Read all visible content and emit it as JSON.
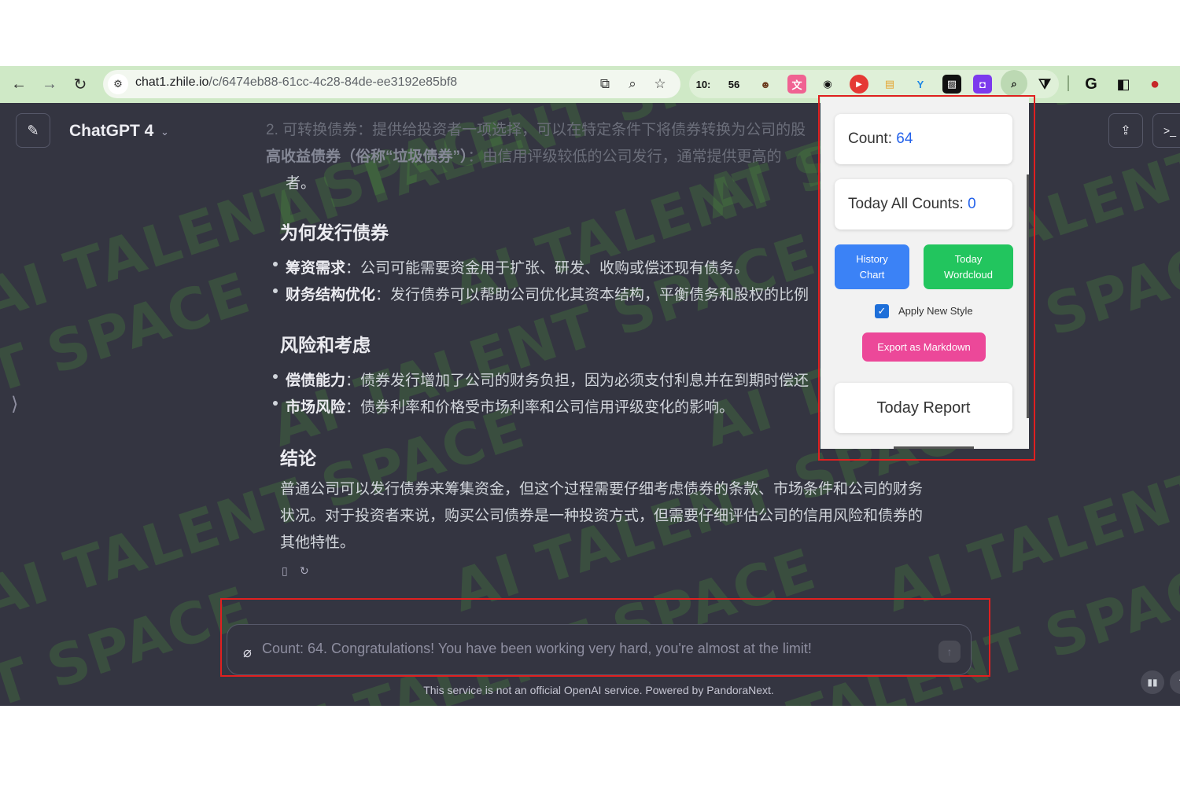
{
  "browser": {
    "url_host": "chat1.zhile.io",
    "url_path": "/c/6474eb88-61cc-4c28-84de-ee3192e85bf8",
    "nav": {
      "back_icon": "←",
      "forward_icon": "→",
      "reload_icon": "↻"
    },
    "tune_icon": "⚙",
    "address_icons": {
      "install": "⧉",
      "zoom": "⌕",
      "star": "☆"
    },
    "extensions": {
      "ext1_label": "10:",
      "ext2_label": "56",
      "ext3_label": "☻",
      "ext4_label": "文",
      "ext5_label": "◉",
      "ext6_label": "▶",
      "ext7_label": "▤",
      "ext8_label": "Y",
      "ext9_label": "▨",
      "ext10_label": "◘",
      "ext11_label": "⌕",
      "ext12_label": "⧩"
    },
    "google_label": "G",
    "sidepanel_icon": "◧",
    "profile_icon": "●"
  },
  "app": {
    "model_name": "ChatGPT 4",
    "model_caret": "⌄",
    "edit_icon": "✎",
    "sidebar_toggle": "⟩",
    "share_icon": "⇪",
    "terminal_icon": ">_"
  },
  "watermark": {
    "text": "AI TALENT SPACE",
    "text_partial": "T SPACE"
  },
  "message": {
    "faded_line1": "2. 可转换债券：提供给投资者一项选择，可以在特定条件下将债券转换为公司的股",
    "faded_line1_bold": "可转换债券",
    "faded_line2_bold": "高收益债券（俗称“垃圾债券”）",
    "faded_line2": "：由信用评级较低的公司发行，通常提供更高的",
    "line_cont": "者。",
    "section1_title": "为何发行债券",
    "s1_item1_bold": "筹资需求",
    "s1_item1_text": "：公司可能需要资金用于扩张、研发、收购或偿还现有债务。",
    "s1_item2_bold": "财务结构优化",
    "s1_item2_text": "：发行债券可以帮助公司优化其资本结构，平衡债务和股权的比例",
    "section2_title": "风险和考虑",
    "s2_item1_bold": "偿债能力",
    "s2_item1_text": "：债券发行增加了公司的财务负担，因为必须支付利息并在到期时偿还",
    "s2_item2_bold": "市场风险",
    "s2_item2_text": "：债券利率和价格受市场利率和公司信用评级变化的影响。",
    "section3_title": "结论",
    "conclusion_line1": "普通公司可以发行债券来筹集资金，但这个过程需要仔细考虑债券的条款、市场条件和公司的财务",
    "conclusion_line2": "状况。对于投资者来说，购买公司债券是一种投资方式，但需要仔细评估公司的信用风险和债券的",
    "conclusion_line3": "其他特性。",
    "copy_icon": "▯",
    "regen_icon": "↻"
  },
  "composer": {
    "attach_icon": "⌀",
    "placeholder": "Count: 64. Congratulations! You have been working very hard, you're almost at the limit!",
    "send_icon": "↑"
  },
  "footer": {
    "note": "This service is not an official OpenAI service. Powered by PandoraNext.",
    "stats_icon": "▮▮",
    "extra_icon": "?"
  },
  "popup": {
    "count_label": "Count: ",
    "count_value": "64",
    "today_label": "Today All Counts: ",
    "today_value": "0",
    "history_btn_line1": "History",
    "history_btn_line2": "Chart",
    "wordcloud_btn_line1": "Today",
    "wordcloud_btn_line2": "Wordcloud",
    "checkbox_label": "Apply New Style",
    "checkbox_checked": true,
    "checkbox_mark": "✓",
    "export_btn": "Export as Markdown",
    "report_btn": "Today Report",
    "colors": {
      "history": "#3b82f6",
      "wordcloud": "#22c55e",
      "export": "#ec4899",
      "accent_num": "#2563eb"
    }
  }
}
